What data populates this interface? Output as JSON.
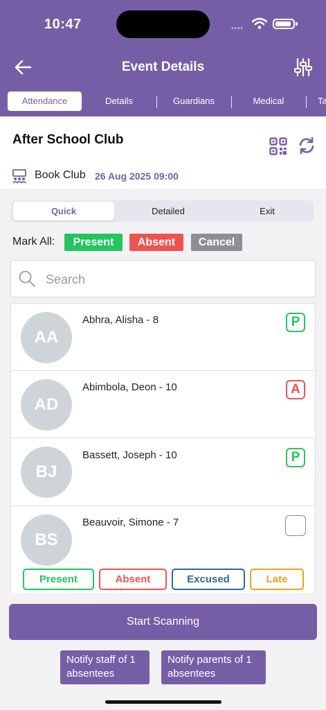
{
  "status_bar": {
    "time": "10:47"
  },
  "header": {
    "title": "Event Details",
    "tabs": [
      {
        "label": "Attendance",
        "active": true
      },
      {
        "label": "Details",
        "active": false
      },
      {
        "label": "Guardians",
        "active": false
      },
      {
        "label": "Medical",
        "active": false
      },
      {
        "label": "Ta",
        "active": false
      }
    ]
  },
  "event": {
    "name": "After School Club",
    "type": "Book Club",
    "datetime": "26 Aug 2025 09:00"
  },
  "mode_segments": [
    {
      "label": "Quick",
      "active": true
    },
    {
      "label": "Detailed",
      "active": false
    },
    {
      "label": "Exit",
      "active": false
    }
  ],
  "mark_all": {
    "label": "Mark All:",
    "present": "Present",
    "absent": "Absent",
    "cancel": "Cancel"
  },
  "search": {
    "placeholder": "Search",
    "value": ""
  },
  "students": [
    {
      "initials": "AA",
      "name": "Abhra, Alisha - 8",
      "status": "P"
    },
    {
      "initials": "AD",
      "name": "Abimbola, Deon - 10",
      "status": "A"
    },
    {
      "initials": "BJ",
      "name": "Bassett, Joseph - 10",
      "status": "P"
    },
    {
      "initials": "BS",
      "name": "Beauvoir, Simone - 7",
      "status": ""
    }
  ],
  "attendance_options": [
    "Present",
    "Absent",
    "Excused",
    "Late"
  ],
  "actions": {
    "start_scanning": "Start Scanning",
    "notify_staff": "Notify staff of 1 absentees",
    "notify_parents": "Notify parents of 1 absentees"
  },
  "colors": {
    "brand": "#765ea6",
    "present": "#22c55e",
    "absent": "#ef5350",
    "cancel": "#8e8f96",
    "excused": "#2f6b91",
    "late": "#f0a020"
  }
}
